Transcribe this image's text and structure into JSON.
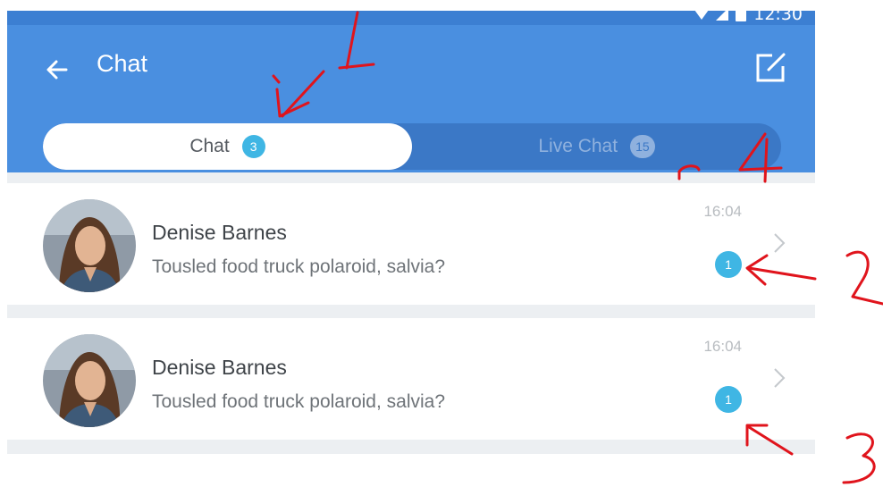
{
  "status_bar": {
    "time": "12:30"
  },
  "header": {
    "title": "Chat",
    "back_icon": "arrow-left-icon",
    "compose_icon": "compose-icon"
  },
  "tabs": [
    {
      "label": "Chat",
      "badge": "3",
      "active": true
    },
    {
      "label": "Live Chat",
      "badge": "15",
      "active": false
    }
  ],
  "conversations": [
    {
      "name": "Denise Barnes",
      "message": "Tousled food truck polaroid, salvia?",
      "time": "16:04",
      "unread": "1"
    },
    {
      "name": "Denise Barnes",
      "message": "Tousled food truck polaroid, salvia?",
      "time": "16:04",
      "unread": "1"
    }
  ],
  "annotations": {
    "labels": [
      "1",
      "2",
      "3",
      "4"
    ]
  },
  "colors": {
    "header": "#4a8fe0",
    "badge": "#3fb6e4",
    "annotation": "#e0141c"
  }
}
